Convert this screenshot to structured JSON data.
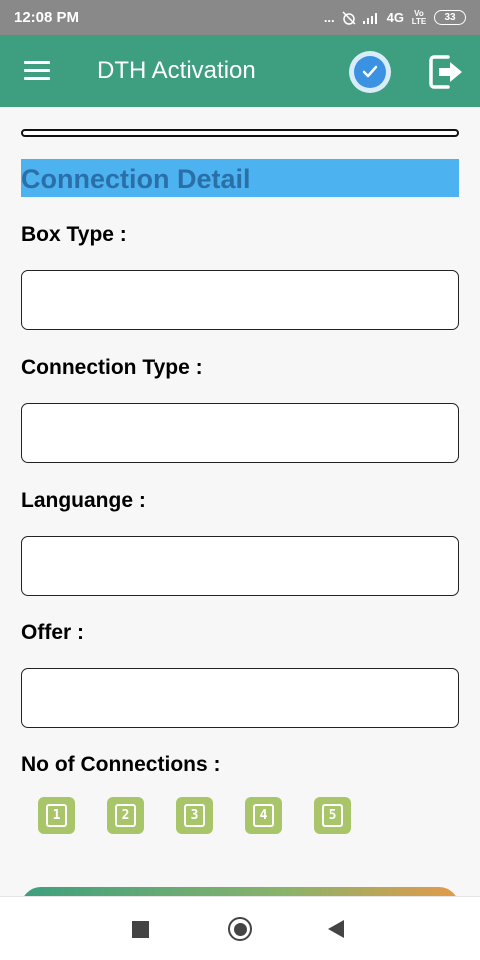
{
  "status_bar": {
    "time": "12:08 PM",
    "dots": "...",
    "network": "4G",
    "volte": "Vo LTE",
    "battery": "33"
  },
  "app_bar": {
    "title": "DTH Activation",
    "icons": [
      "menu-icon",
      "check-circle-icon",
      "logout-icon"
    ],
    "color": "#3d9f7f"
  },
  "section": {
    "title": "Connection Detail",
    "color": "#4db2f0"
  },
  "fields": {
    "box_type": {
      "label": "Box Type :",
      "value": ""
    },
    "connection_type": {
      "label": "Connection Type :",
      "value": ""
    },
    "language": {
      "label": "Languange :",
      "value": ""
    },
    "offer": {
      "label": "Offer :",
      "value": ""
    }
  },
  "connections": {
    "label": "No of Connections :",
    "options": [
      "1",
      "2",
      "3",
      "4",
      "5"
    ],
    "color": "#a9c56a"
  },
  "nav_bar": {
    "icons": [
      "recents-square-icon",
      "home-circle-icon",
      "back-triangle-icon"
    ]
  }
}
